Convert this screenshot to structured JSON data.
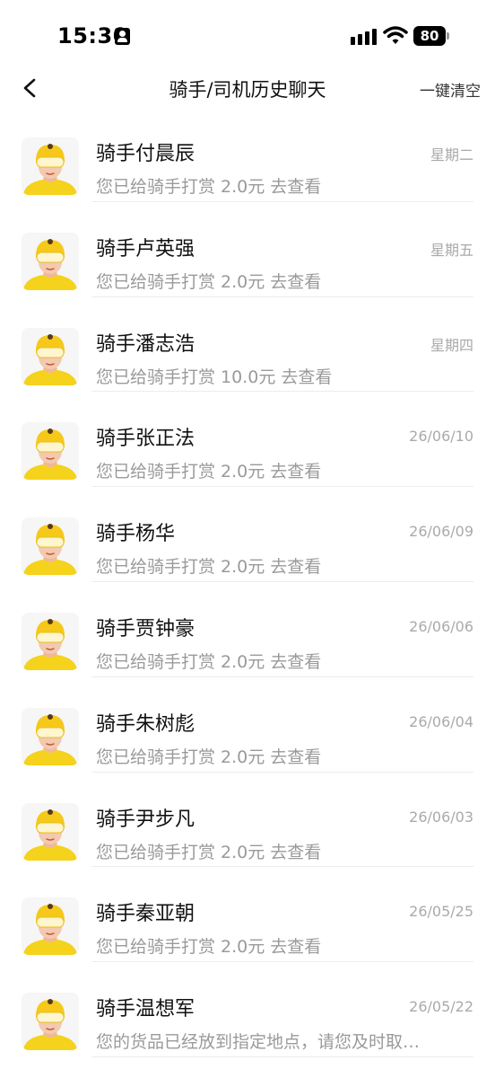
{
  "status_bar": {
    "time": "15:30",
    "battery": "80"
  },
  "nav": {
    "title": "骑手/司机历史聊天",
    "action": "一键清空"
  },
  "chats": [
    {
      "name": "骑手付晨辰",
      "time": "星期二",
      "preview": "您已给骑手打赏 2.0元 去查看"
    },
    {
      "name": "骑手卢英强",
      "time": "星期五",
      "preview": "您已给骑手打赏 2.0元 去查看"
    },
    {
      "name": "骑手潘志浩",
      "time": "星期四",
      "preview": "您已给骑手打赏 10.0元 去查看"
    },
    {
      "name": "骑手张正法",
      "time": "26/06/10",
      "preview": "您已给骑手打赏 2.0元 去查看"
    },
    {
      "name": "骑手杨华",
      "time": "26/06/09",
      "preview": "您已给骑手打赏 2.0元 去查看"
    },
    {
      "name": "骑手贾钟豪",
      "time": "26/06/06",
      "preview": "您已给骑手打赏 2.0元 去查看"
    },
    {
      "name": "骑手朱树彪",
      "time": "26/06/04",
      "preview": "您已给骑手打赏 2.0元 去查看"
    },
    {
      "name": "骑手尹步凡",
      "time": "26/06/03",
      "preview": "您已给骑手打赏 2.0元 去查看"
    },
    {
      "name": "骑手秦亚朝",
      "time": "26/05/25",
      "preview": "您已给骑手打赏 2.0元 去查看"
    },
    {
      "name": "骑手温想军",
      "time": "26/05/22",
      "preview": "您的货品已经放到指定地点，请您及时取…"
    }
  ],
  "colors": {
    "helmet": "#f5c81a",
    "skin": "#f3c9b0",
    "visor": "#fff6cf",
    "shirt": "#f5d21c"
  },
  "icons": {
    "back": "chevron-left-icon",
    "signal": "signal-icon",
    "wifi": "wifi-icon",
    "battery": "battery-icon",
    "avatar": "rider-avatar-icon"
  }
}
